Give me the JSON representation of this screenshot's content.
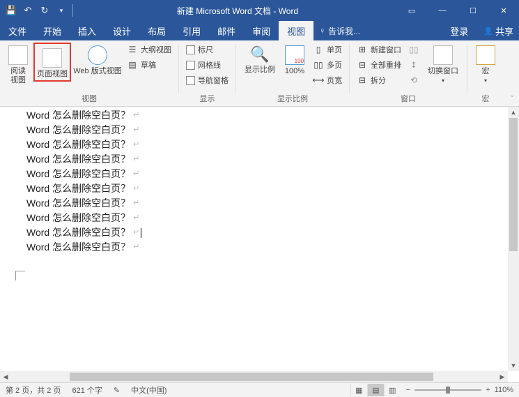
{
  "title": "新建 Microsoft Word 文档 - Word",
  "tabs": {
    "file": "文件",
    "home": "开始",
    "insert": "插入",
    "design": "设计",
    "layout": "布局",
    "references": "引用",
    "mail": "邮件",
    "review": "审阅",
    "view": "视图",
    "tellme": "告诉我...",
    "login": "登录",
    "share": "共享"
  },
  "ribbon": {
    "views": {
      "read": "阅读\n视图",
      "print": "页面视图",
      "web": "Web 版式视图",
      "outline": "大纲视图",
      "draft": "草稿",
      "group": "视图"
    },
    "show": {
      "ruler": "标尺",
      "grid": "网格线",
      "nav": "导航窗格",
      "group": "显示"
    },
    "zoom": {
      "zoom": "显示比例",
      "pct": "100%",
      "onepage": "单页",
      "multipage": "多页",
      "pagewidth": "页宽",
      "group": "显示比例"
    },
    "window": {
      "newwin": "新建窗口",
      "arrange": "全部重排",
      "split": "拆分",
      "side": "并排查看",
      "sync": "同步滚动",
      "reset": "重设窗口位置",
      "switch": "切换窗口",
      "group": "窗口"
    },
    "macros": {
      "macro": "宏",
      "group": "宏"
    }
  },
  "doc": {
    "line": "Word 怎么删除空白页？",
    "count": 10
  },
  "status": {
    "page": "第 2 页，共 2 页",
    "words": "621 个字",
    "lang": "中文(中国)",
    "zoom": "110%"
  }
}
